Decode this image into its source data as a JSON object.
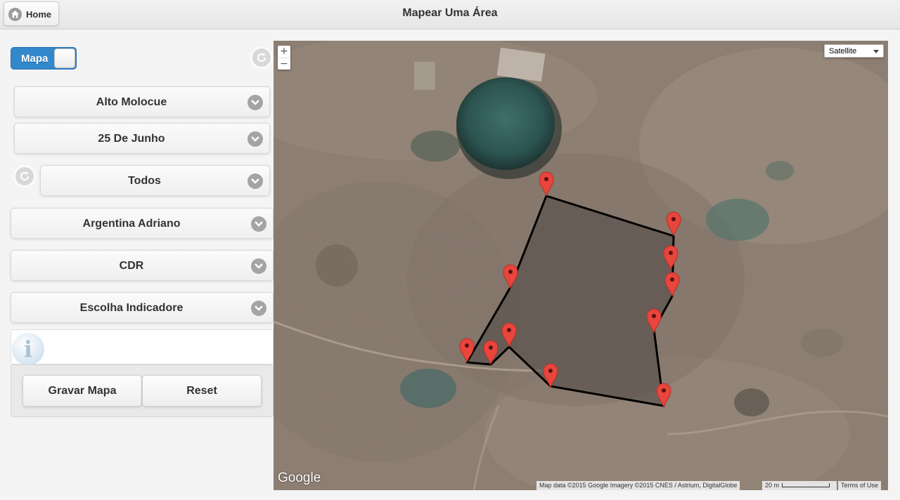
{
  "header": {
    "title": "Mapear Uma Área",
    "home_label": "Home"
  },
  "sidebar": {
    "mode_toggle": {
      "label": "Mapa",
      "on": true
    },
    "selects": [
      {
        "label": "Alto Molocue"
      },
      {
        "label": "25 De Junho"
      },
      {
        "label": "Todos"
      },
      {
        "label": "Argentina Adriano"
      },
      {
        "label": "CDR"
      },
      {
        "label": "Escolha Indicadore"
      }
    ],
    "actions": {
      "save_label": "Gravar Mapa",
      "reset_label": "Reset"
    }
  },
  "map": {
    "map_type": "Satellite",
    "zoom_in": "+",
    "zoom_out": "−",
    "logo": "Google",
    "attribution": "Map data ©2015 Google Imagery ©2015 CNES / Astrium, DigitalGlobe",
    "scale_label": "20 m",
    "terms": "Terms of Use",
    "polygon_fill": "#5b5450",
    "polygon_stroke": "#000000",
    "marker_color": "#e8453c",
    "marker_count": 12
  }
}
